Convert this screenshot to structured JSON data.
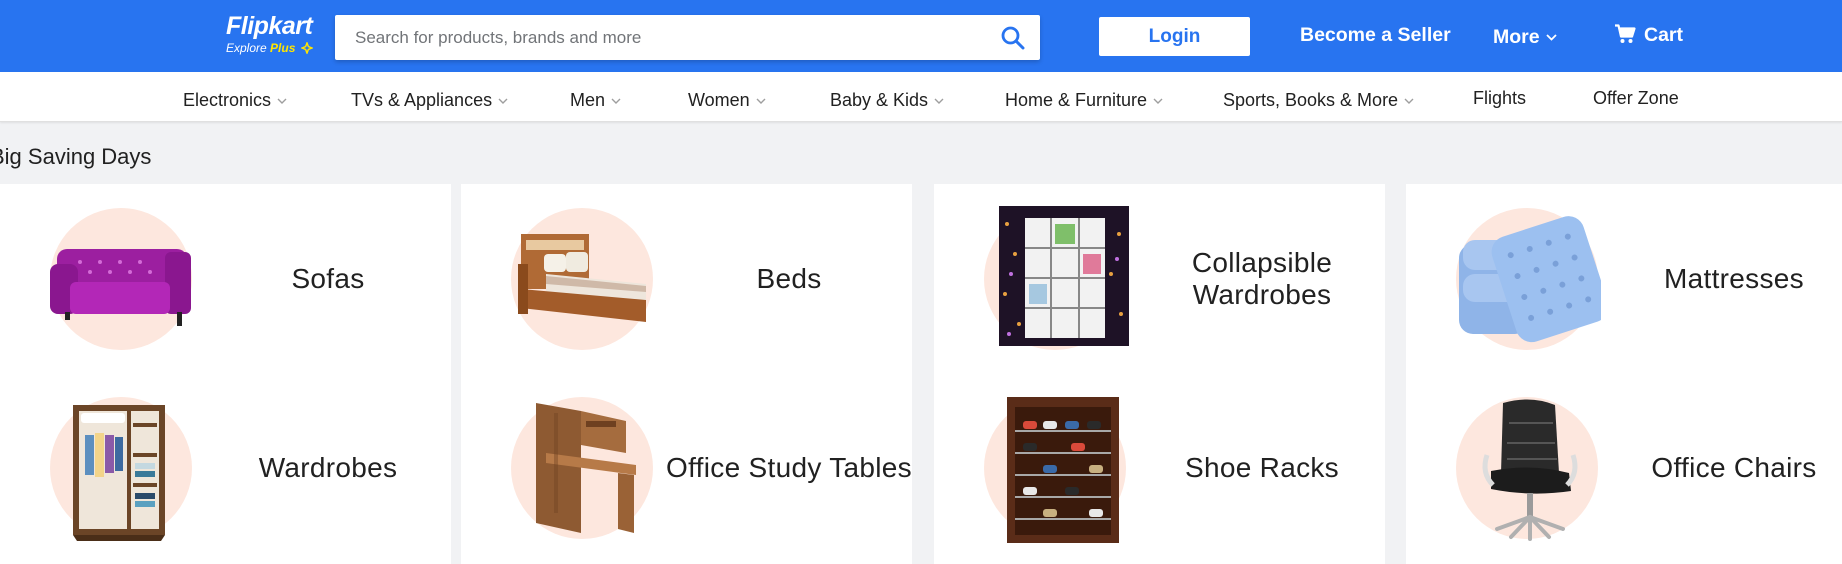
{
  "header": {
    "logo": {
      "name": "Flipkart",
      "tagline": "Explore",
      "tagline_plus": "Plus"
    },
    "search": {
      "placeholder": "Search for products, brands and more",
      "value": ""
    },
    "login_label": "Login",
    "seller_label": "Become a Seller",
    "more_label": "More",
    "cart_label": "Cart"
  },
  "categories": [
    {
      "label": "Electronics",
      "dropdown": true
    },
    {
      "label": "TVs & Appliances",
      "dropdown": true
    },
    {
      "label": "Men",
      "dropdown": true
    },
    {
      "label": "Women",
      "dropdown": true
    },
    {
      "label": "Baby & Kids",
      "dropdown": true
    },
    {
      "label": "Home & Furniture",
      "dropdown": true
    },
    {
      "label": "Sports, Books & More",
      "dropdown": true
    },
    {
      "label": "Flights",
      "dropdown": false
    },
    {
      "label": "Offer Zone",
      "dropdown": false
    }
  ],
  "section": {
    "title": "Big Saving Days",
    "cards": [
      {
        "top": {
          "label": "Sofas",
          "icon": "sofa-icon"
        },
        "bottom": {
          "label": "Wardrobes",
          "icon": "wardrobe-icon"
        }
      },
      {
        "top": {
          "label": "Beds",
          "icon": "bed-icon"
        },
        "bottom": {
          "label": "Office Study Tables",
          "icon": "study-table-icon"
        }
      },
      {
        "top": {
          "label": "Collapsible Wardrobes",
          "icon": "collapsible-wardrobe-icon"
        },
        "bottom": {
          "label": "Shoe Racks",
          "icon": "shoe-rack-icon"
        }
      },
      {
        "top": {
          "label": "Mattresses",
          "icon": "mattress-icon"
        },
        "bottom": {
          "label": "Office Chairs",
          "icon": "office-chair-icon"
        }
      }
    ]
  },
  "colors": {
    "brand": "#2874f0",
    "accent_yellow": "#ffe500",
    "circle_bg": "#fde7de",
    "page_bg": "#f1f2f4"
  }
}
